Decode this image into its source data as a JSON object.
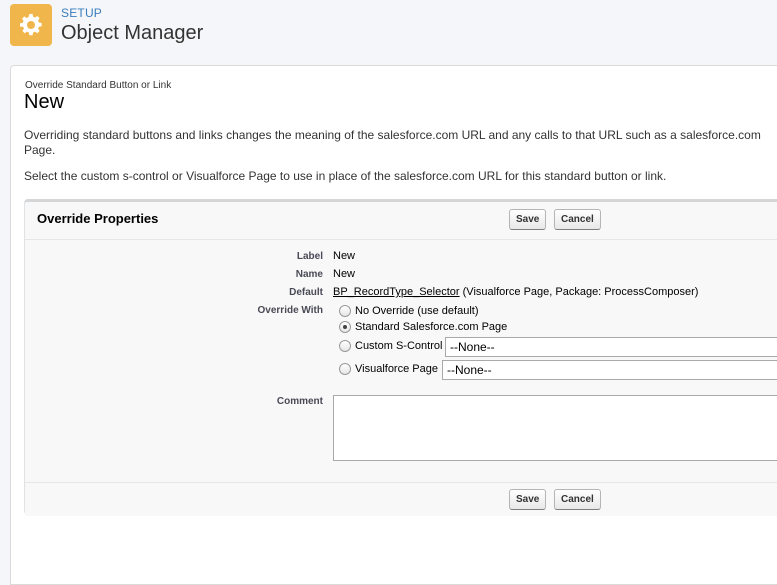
{
  "header": {
    "setup_label": "SETUP",
    "title": "Object Manager",
    "icon": "gear-icon",
    "icon_color": "#f0b64b"
  },
  "page": {
    "caption": "Override Standard Button or Link",
    "title": "New",
    "description_1": "Overriding standard buttons and links changes the meaning of the salesforce.com URL and any calls to that URL such as a salesforce.com Page.",
    "description_2": "Select the custom s-control or Visualforce Page to use in place of the salesforce.com URL for this standard button or link."
  },
  "properties": {
    "title": "Override Properties",
    "save_label": "Save",
    "cancel_label": "Cancel",
    "fields": {
      "label_label": "Label",
      "label_value": "New",
      "name_label": "Name",
      "name_value": "New",
      "default_label": "Default",
      "default_link": "BP_RecordType_Selector",
      "default_suffix": "(Visualforce Page, Package: ProcessComposer)",
      "override_label": "Override With",
      "comment_label": "Comment"
    },
    "options": {
      "no_override": "No Override (use default)",
      "standard_page": "Standard Salesforce.com Page",
      "custom_scontrol": "Custom S-Control",
      "visualforce_page": "Visualforce Page",
      "selected": "Standard Salesforce.com Page"
    },
    "scontrol_select_value": "--None--",
    "visualforce_select_value": "--None--",
    "comment_value": ""
  }
}
